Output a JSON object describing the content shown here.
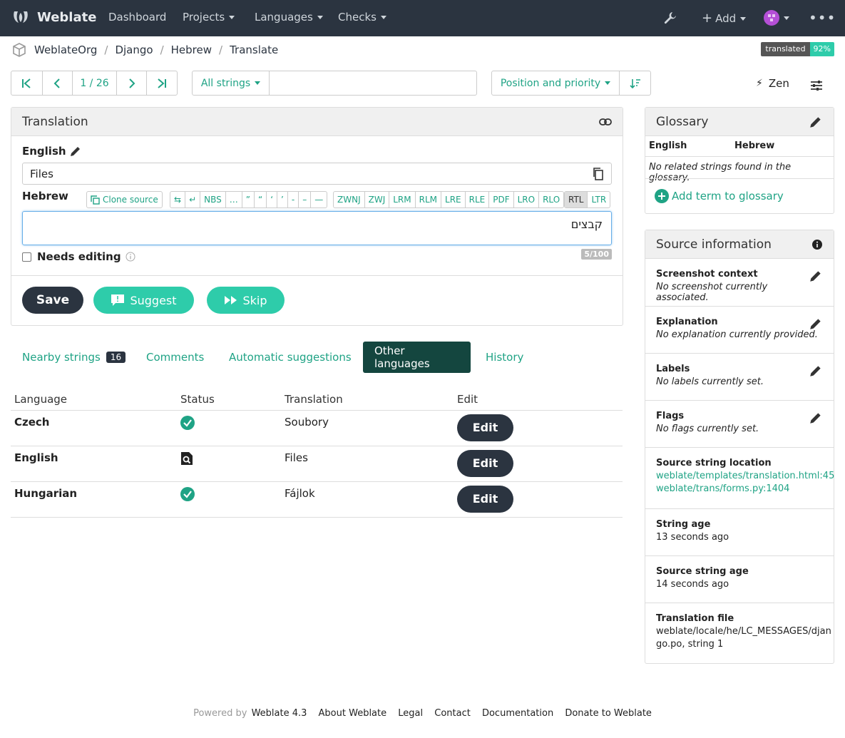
{
  "navbar": {
    "brand": "Weblate",
    "items": [
      "Dashboard",
      "Projects",
      "Languages",
      "Checks"
    ],
    "add": "Add"
  },
  "breadcrumb": [
    "WeblateOrg",
    "Django",
    "Hebrew",
    "Translate"
  ],
  "badge": {
    "label": "translated",
    "value": "92%"
  },
  "toolbar": {
    "position": "1 / 26",
    "filter": "All strings",
    "search_value": "",
    "sort": "Position and priority",
    "zen": "Zen"
  },
  "translation": {
    "title": "Translation",
    "source_lang": "English",
    "source_text": "Files",
    "target_lang": "Hebrew",
    "clone_source": "Clone source",
    "chips": [
      "⇆",
      "↵",
      "NBS",
      "…",
      "”",
      "“",
      "‘",
      "’",
      "-",
      "–",
      "—"
    ],
    "chips2": [
      "ZWNJ",
      "ZWJ",
      "LRM",
      "RLM",
      "LRE",
      "RLE",
      "PDF",
      "LRO",
      "RLO"
    ],
    "dir": [
      "RTL",
      "LTR"
    ],
    "target_text": "קבצים",
    "needs_editing": "Needs editing",
    "counter": "5/100",
    "save": "Save",
    "suggest": "Suggest",
    "skip": "Skip"
  },
  "tabs": {
    "nearby": "Nearby strings",
    "nearby_count": "16",
    "comments": "Comments",
    "auto": "Automatic suggestions",
    "other": "Other languages",
    "history": "History"
  },
  "languages": {
    "headers": [
      "Language",
      "Status",
      "Translation",
      "Edit"
    ],
    "rows": [
      {
        "language": "Czech",
        "status": "translated",
        "translation": "Soubory",
        "edit": "Edit"
      },
      {
        "language": "English",
        "status": "source",
        "translation": "Files",
        "edit": "Edit"
      },
      {
        "language": "Hungarian",
        "status": "translated",
        "translation": "Fájlok",
        "edit": "Edit"
      }
    ]
  },
  "glossary": {
    "title": "Glossary",
    "col1": "English",
    "col2": "Hebrew",
    "empty": "No related strings found in the glossary.",
    "add": "Add term to glossary"
  },
  "source_info": {
    "title": "Source information",
    "screenshot_t": "Screenshot context",
    "screenshot_v": "No screenshot currently associated.",
    "explanation_t": "Explanation",
    "explanation_v": "No explanation currently provided.",
    "labels_t": "Labels",
    "labels_v": "No labels currently set.",
    "flags_t": "Flags",
    "flags_v": "No flags currently set.",
    "location_t": "Source string location",
    "location_1": "weblate/templates/translation.html:45",
    "location_2": "weblate/trans/forms.py:1404",
    "age_t": "String age",
    "age_v": "13 seconds ago",
    "src_age_t": "Source string age",
    "src_age_v": "14 seconds ago",
    "file_t": "Translation file",
    "file_v1": "weblate/locale/he/LC_MESSAGES/djan",
    "file_v2": "go.po, string 1"
  },
  "footer": {
    "powered": "Powered by",
    "version": "Weblate 4.3",
    "links": [
      "About Weblate",
      "Legal",
      "Contact",
      "Documentation",
      "Donate to Weblate"
    ]
  }
}
